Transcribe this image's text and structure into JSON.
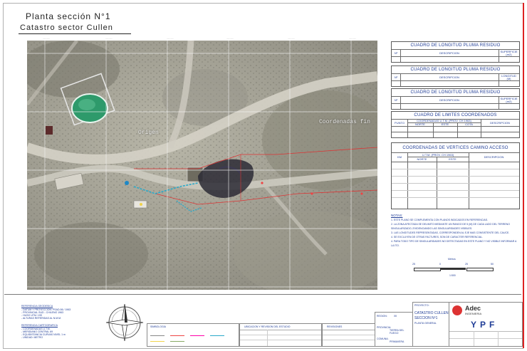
{
  "title": {
    "line1": "Planta sección N°1",
    "line2": "Catastro sector Cullen"
  },
  "map": {
    "labels": [
      "Origen",
      "Coordenadas fin"
    ],
    "colors": {
      "ground": "#a9a79b",
      "road": "#cfccc2",
      "pond": "#2e9a6b",
      "boundary": "#d33",
      "grid": "#f4f4f4"
    }
  },
  "panels": {
    "residue_length_a": {
      "title": "CUADRO DE LONGITUD PLUMA RESIDUO",
      "col_n": "Nº",
      "col_desc": "DESCRIPCION",
      "col_area": "SUPERFICIE",
      "col_area_unit": "(m2)"
    },
    "residue_length_b": {
      "title": "CUADRO DE LONGITUD PLUMA RESIDUO",
      "col_n": "Nº",
      "col_desc": "DESCRIPCION",
      "col_len": "LONGITUD",
      "col_len_unit": "(M)"
    },
    "residue_length_c": {
      "title": "CUADRO DE LONGITUD PLUMA RESIDUO",
      "col_n": "Nº",
      "col_desc": "DESCRIPCION",
      "col_area": "SUPERFICIE",
      "col_area_unit": "(m2)"
    },
    "limits": {
      "title": "CUADRO DE LIMITES COORDENADOS",
      "col_point": "PUNTO",
      "col_coords": "COORDENADAS U.T.M. (PROV. CH 1963)",
      "col_north": "NORTE",
      "col_east": "ESTE",
      "col_level": "COTA",
      "col_desc": "DESCRIPCION"
    },
    "access": {
      "title": "COORDENADAS DE VERTICES CAMINO ACCESO",
      "col_km": "KM",
      "col_utm": "U.T.M. (PROV. CH 1963)",
      "col_north": "NORTE",
      "col_east": "ESTE",
      "col_desc": "DESCRIPCION"
    }
  },
  "notes": {
    "title": "NOTAS:",
    "items": [
      "1. ESTE PLANO SE COMPLEMENTA CON PLANOS INDICADOS EN REFERENCIAS.",
      "2. LA ZONA AFECTADA SE DELIMITO MEDIANTE UN RANGO DE 5 (M) DE CADA LADO DEL TERRENO SINGULARIZADO, EVIDENCIANDO LAS SINGULARIDADES VISIBLES.",
      "3. LAS LONGITUDES REPRESENTADAS, CORRESPONDEN AL EJE MAS CONSISTENTE DEL CAUCE.",
      "4. SE EXCLUYEN DE OTRAS FACTURES, SON DE CARACTER REFERENCIAL.",
      "4. PARA TODO TIPO DE SINGULARIDADES NO DETECTADAS EN ESTE PLANO Y NO VISIBLE INFORMAR A LA ITO."
    ]
  },
  "scale": {
    "title": "Metros",
    "ticks": [
      "25",
      "0",
      "25",
      "50"
    ],
    "ratio": "1:500"
  },
  "bottom": {
    "references_title": "REFERENCIA GEODESICA",
    "references": [
      "- DATUM Y PROYECCION: PSAD-56 / 1963",
      "- PROVINCIAL SUD - CHILENO 1963",
      "- HUSO UTM: 19S",
      "- ALTURAS REFERIDAS AL N.M.M."
    ],
    "carto_title": "REFERENCIA CARTOGRAFICA",
    "carto": [
      "- COORDENADAS U.T.M.",
      "- MERIDIANO CENTRAL 69",
      "- EQUIDISTANCIA CURVAS NIVEL 1 m",
      "- UNIDAD: METRO"
    ],
    "symbology_title": "SIMBOLOGIA",
    "location_title": "UBICACION Y REVISION DEL ESTUDIO",
    "revisions_title": "REVISIONES",
    "region_label": "REGION:",
    "region_value": "XII",
    "province_label": "PROVINCIA:",
    "province_value": "TIERRA DEL FUEGO",
    "commune_label": "COMUNA:",
    "commune_value": "PRIMAVERA",
    "project_label": "PROYECTO:",
    "project_line1": "CATASTRO CULLEN",
    "project_line2": "SECCION Nº1",
    "project_line3": "PLANTA GENERAL",
    "company": "Adec",
    "company_sub": "INGENIERIA",
    "client": "YPF"
  }
}
